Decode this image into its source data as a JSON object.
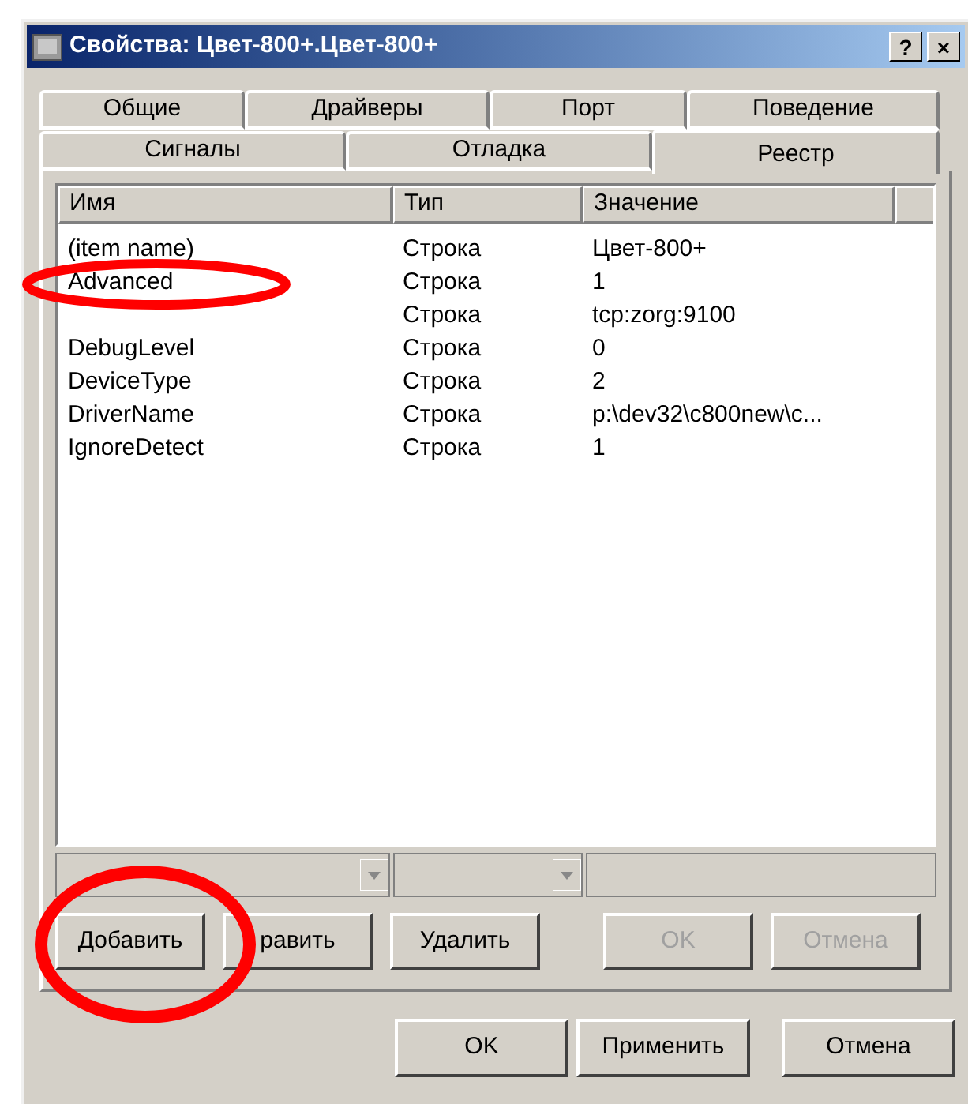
{
  "window": {
    "title": "Свойства: Цвет-800+.Цвет-800+",
    "buttons": [
      "?",
      "×"
    ]
  },
  "tab_rows": [
    [
      {
        "label": "Общие",
        "selected": false
      },
      {
        "label": "Драйверы",
        "selected": false
      },
      {
        "label": "Порт",
        "selected": false
      },
      {
        "label": "Поведение",
        "selected": false
      }
    ],
    [
      {
        "label": "Сигналы",
        "selected": false
      },
      {
        "label": "Отладка",
        "selected": false
      },
      {
        "label": "Реестр",
        "selected": true
      }
    ]
  ],
  "table": {
    "columns": [
      "Имя",
      "Тип",
      "Значение"
    ],
    "rows": [
      {
        "name": "(item name)",
        "type": "Строка",
        "value": "Цвет-800+"
      },
      {
        "name": "Advanced",
        "type": "Строка",
        "value": "1"
      },
      {
        "type": "Строка",
        "value": "tcp:zorg:9100"
      },
      {
        "name": "DebugLevel",
        "type": "Строка",
        "value": "0"
      },
      {
        "name": "DeviceType",
        "type": "Строка",
        "value": "2"
      },
      {
        "name": "DriverName",
        "type": "Строка",
        "value": "p:\\dev32\\c800new\\c..."
      },
      {
        "name": "IgnoreDetect",
        "type": "Строка",
        "value": "1"
      }
    ]
  },
  "editor_buttons": [
    {
      "label": "Добавить",
      "disabled": false
    },
    {
      "label": "равить",
      "disabled": false
    },
    {
      "label": "Удалить",
      "disabled": false
    },
    {
      "label": "OK",
      "disabled": true
    },
    {
      "label": "Отмена",
      "disabled": true
    }
  ],
  "dialog_buttons": [
    "OK",
    "Применить",
    "Отмена"
  ],
  "annotations": [
    {
      "kind": "ellipse"
    },
    {
      "kind": "ellipse"
    }
  ]
}
